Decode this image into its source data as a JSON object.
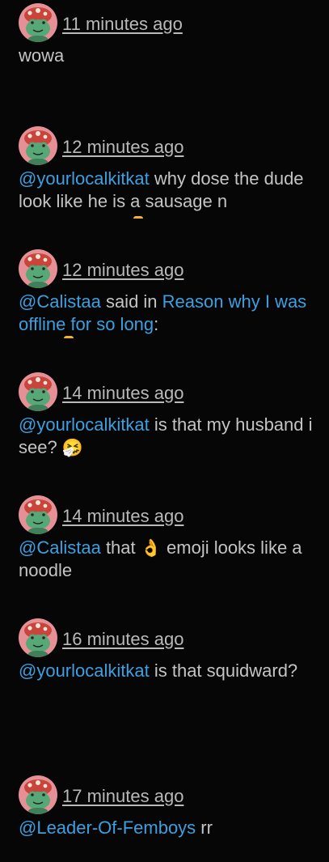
{
  "avatar_icon": "frog-mushroom-avatar-icon",
  "colors": {
    "background": "#060606",
    "text": "#c4c4c4",
    "link": "#3d9fe0",
    "avatar_bg": "#e59096"
  },
  "posts": [
    {
      "time": "11 minutes ago",
      "text": "wowa"
    },
    {
      "time": "12 minutes ago",
      "mention": "@yourlocalkitkat",
      "text": " why dose the dude look like he is a sausage n"
    },
    {
      "time": "12 minutes ago",
      "mention": "@Calistaa",
      "text": " said in ",
      "link": "Reason why I was offline for so long",
      "text_after": ":"
    },
    {
      "time": "14 minutes ago",
      "mention": "@yourlocalkitkat",
      "text": " is that my husband i see? ",
      "emoji": "🤧"
    },
    {
      "time": "14 minutes ago",
      "mention": "@Calistaa",
      "text": " that ",
      "emoji": "👌",
      "text_after": " emoji looks like a noodle"
    },
    {
      "time": "16 minutes ago",
      "mention": "@yourlocalkitkat",
      "text": " is that squidward?"
    },
    {
      "time": "17 minutes ago",
      "mention": "@Leader-Of-Femboys",
      "text": " rr"
    }
  ]
}
